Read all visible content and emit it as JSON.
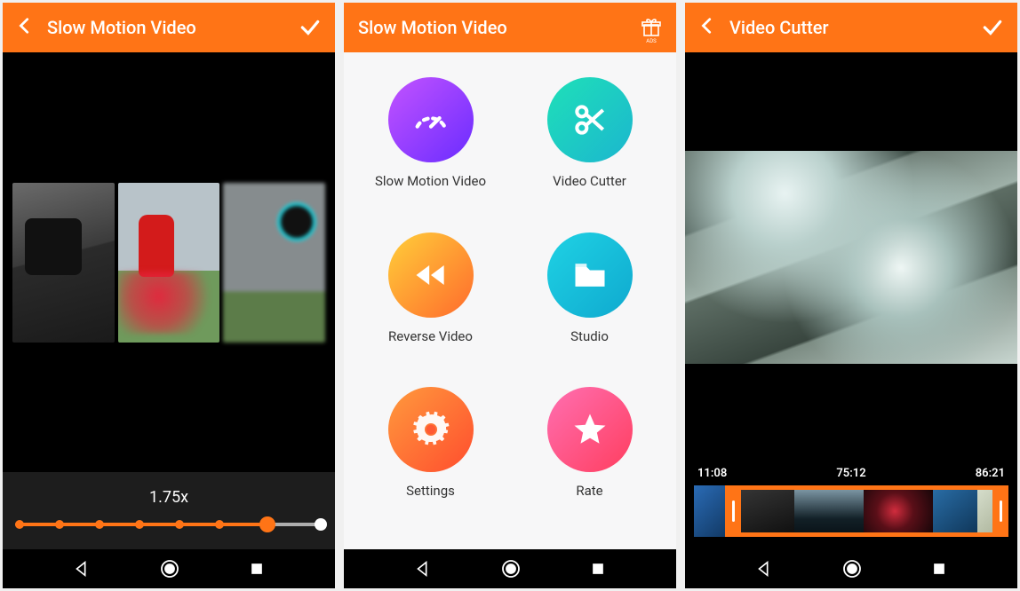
{
  "screen1": {
    "title": "Slow Motion Video",
    "speed_label": "1.75x"
  },
  "screen2": {
    "title": "Slow Motion Video",
    "items": [
      {
        "label": "Slow Motion Video",
        "icon": "speedometer-icon",
        "gradient": "g-purple"
      },
      {
        "label": "Video Cutter",
        "icon": "scissors-icon",
        "gradient": "g-teal"
      },
      {
        "label": "Reverse Video",
        "icon": "rewind-icon",
        "gradient": "g-orange"
      },
      {
        "label": "Studio",
        "icon": "folder-icon",
        "gradient": "g-blue"
      },
      {
        "label": "Settings",
        "icon": "gear-icon",
        "gradient": "g-darkorange"
      },
      {
        "label": "Rate",
        "icon": "star-icon",
        "gradient": "g-pink"
      }
    ]
  },
  "screen3": {
    "title": "Video Cutter",
    "time_start": "11:08",
    "time_current": "75:12",
    "time_end": "86:21"
  }
}
